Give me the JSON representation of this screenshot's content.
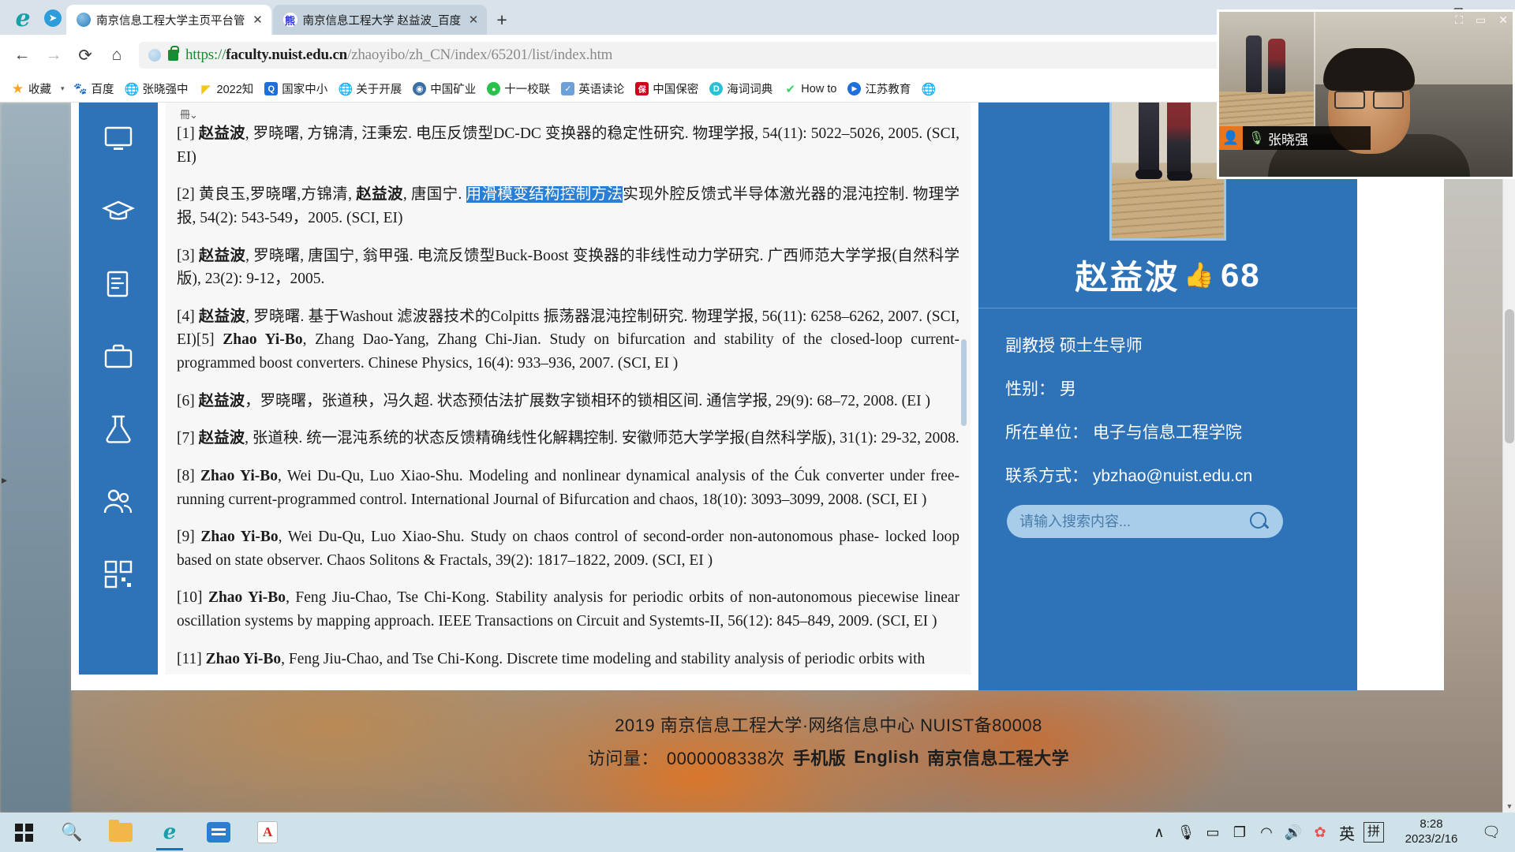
{
  "browser": {
    "tabs": [
      {
        "title": "南京信息工程大学主页平台管",
        "favicon": "globe-favicon",
        "active": true,
        "close_label": "✕"
      },
      {
        "title": "南京信息工程大学 赵益波_百度",
        "favicon": "baidu-favicon",
        "active": false,
        "close_label": "✕"
      }
    ],
    "new_tab_label": "+",
    "window_buttons": [
      "—",
      "❐",
      "✕"
    ],
    "nav": {
      "back": "←",
      "forward": "→",
      "reload": "⟳",
      "home": "⌂",
      "read_aloud": "⚡",
      "more": "⋯",
      "collections": "⌄"
    },
    "url": {
      "scheme": "https://",
      "host": "faculty.nuist.edu.cn",
      "path": "/zhaoyibo/zh_CN/index/65201/list/index.htm"
    },
    "bookmarks": [
      {
        "label": "收藏",
        "icon": "star-icon",
        "color": "#f5a623"
      },
      {
        "label": "百度",
        "icon": "baidu-icon",
        "color": "#2932e1"
      },
      {
        "label": "张晓强中",
        "icon": "globe-icon",
        "color": "#8d8d8d"
      },
      {
        "label": "2022知",
        "icon": "triangle-icon",
        "color": "#f5c518"
      },
      {
        "label": "国家中小",
        "icon": "app-icon",
        "color": "#1e6fd9"
      },
      {
        "label": "关于开展",
        "icon": "globe-icon",
        "color": "#8d8d8d"
      },
      {
        "label": "中国矿业",
        "icon": "seal-icon",
        "color": "#3b6ea5"
      },
      {
        "label": "十一校联",
        "icon": "wechat-icon",
        "color": "#27c24c"
      },
      {
        "label": "英语读论",
        "icon": "doc-icon",
        "color": "#6ca0d6"
      },
      {
        "label": "中国保密",
        "icon": "shield-icon",
        "color": "#d0021b"
      },
      {
        "label": "海词词典",
        "icon": "dict-icon",
        "color": "#29c1d6"
      },
      {
        "label": "How to",
        "icon": "leaf-icon",
        "color": "#3dd16a"
      },
      {
        "label": "江苏教育",
        "icon": "play-icon",
        "color": "#1e6fd9"
      },
      {
        "label": "",
        "icon": "globe-icon",
        "color": "#8d8d8d"
      }
    ],
    "bookmark_caret": "▾"
  },
  "page": {
    "rail_items": [
      {
        "name": "monitor-icon"
      },
      {
        "name": "graduation-cap-icon"
      },
      {
        "name": "document-pen-icon"
      },
      {
        "name": "briefcase-icon"
      },
      {
        "name": "flask-icon"
      },
      {
        "name": "people-icon"
      },
      {
        "name": "qrcode-icon"
      }
    ],
    "fragment_glyph": "冊⌄",
    "publications": [
      "[1] 赵益波, 罗晓曙, 方锦清, 汪秉宏. 电压反馈型DC-DC 变换器的稳定性研究. 物理学报, 54(11): 5022–5026, 2005. (SCI, EI)",
      "[2] 黄良玉,罗晓曙,方锦清, 赵益波, 唐国宁. 用滑模变结构控制方法实现外腔反馈式半导体激光器的混沌控制. 物理学报, 54(2): 543-549，2005. (SCI, EI)",
      "[3] 赵益波, 罗晓曙, 唐国宁, 翁甲强. 电流反馈型Buck-Boost 变换器的非线性动力学研究. 广西师范大学学报(自然科学版), 23(2): 9-12，2005.",
      "[4] 赵益波, 罗晓曙. 基于Washout 滤波器技术的Colpitts 振荡器混沌控制研究. 物理学报, 56(11): 6258–6262, 2007. (SCI, EI)[5] Zhao Yi-Bo, Zhang Dao-Yang, Zhang Chi-Jian. Study on bifurcation and stability of the closed-loop current-programmed boost converters. Chinese Physics, 16(4): 933–936, 2007. (SCI, EI )",
      "[6] 赵益波，罗晓曙，张道秧，冯久超. 状态预估法扩展数字锁相环的锁相区间. 通信学报, 29(9): 68–72, 2008. (EI )",
      "[7] 赵益波, 张道秧. 统一混沌系统的状态反馈精确线性化解耦控制. 安徽师范大学学报(自然科学版), 31(1): 29-32, 2008.",
      "[8] Zhao Yi-Bo, Wei Du-Qu, Luo Xiao-Shu. Modeling and nonlinear dynamical analysis of the Ćuk converter under free-running current-programmed control.  International Journal of Bifurcation and chaos, 18(10): 3093–3099, 2008. (SCI, EI )",
      "[9] Zhao Yi-Bo, Wei Du-Qu, Luo Xiao-Shu. Study on chaos control of second-order non-autonomous phase- locked loop based on state observer. Chaos Solitons & Fractals, 39(2): 1817–1822, 2009. (SCI, EI )",
      "[10] Zhao Yi-Bo, Feng Jiu-Chao, Tse Chi-Kong. Stability analysis for periodic orbits of non-autonomous piecewise linear oscillation systems by mapping approach. IEEE Transactions on Circuit and Systemts-II, 56(12): 845–849, 2009. (SCI, EI )",
      "[11] Zhao Yi-Bo, Feng Jiu-Chao, and Tse Chi-Kong. Discrete time modeling and stability analysis of periodic orbits with"
    ],
    "highlight_text": "用滑模变结构控制方法",
    "profile": {
      "name": "赵益波",
      "thumbs_icon": "thumbs-up-icon",
      "likes": "68",
      "title_line": "副教授 硕士生导师",
      "fields": [
        {
          "label": "性别：",
          "value": "男"
        },
        {
          "label": "所在单位：",
          "value": "电子与信息工程学院"
        },
        {
          "label": "联系方式：",
          "value": "ybzhao@nuist.edu.cn"
        }
      ],
      "search_placeholder": "请输入搜索内容...",
      "search_value": "",
      "search_icon": "search-icon"
    },
    "footer": {
      "line1": "2019 南京信息工程大学·网络信息中心 NUIST备80008",
      "visits_label": "访问量：",
      "visits_value": "0000008338次",
      "links": [
        "手机版",
        "English",
        "南京信息工程大学"
      ]
    }
  },
  "video_call": {
    "participant_name": "张晓强",
    "avatar_icon": "person-icon",
    "mic_icon": "microphone-icon",
    "top_buttons": [
      "⛶",
      "▭",
      "✕"
    ]
  },
  "taskbar": {
    "start_icon": "windows-logo",
    "search_icon": "search-icon",
    "apps": [
      {
        "name": "file-explorer-icon"
      },
      {
        "name": "edge-browser-icon",
        "active": true
      },
      {
        "name": "wps-office-icon"
      },
      {
        "name": "pdf-reader-icon"
      }
    ],
    "tray": [
      {
        "name": "show-hidden-icons",
        "glyph": "∧"
      },
      {
        "name": "microphone-icon",
        "glyph": "🎙"
      },
      {
        "name": "battery-icon",
        "glyph": "▭"
      },
      {
        "name": "display-settings-icon",
        "glyph": "❐"
      },
      {
        "name": "wifi-icon",
        "glyph": "◠"
      },
      {
        "name": "volume-icon",
        "glyph": "🔊"
      },
      {
        "name": "sogou-icon",
        "glyph": "✿"
      },
      {
        "name": "input-lang-icon",
        "glyph": "英"
      },
      {
        "name": "pinyin-mode-icon",
        "glyph": "拼"
      }
    ],
    "clock_time": "8:28",
    "clock_date": "2023/2/16",
    "notification_icon": "▭"
  },
  "colors": {
    "accent_blue": "#2e72b8",
    "highlight_blue": "#2a7fd4",
    "link_green": "#1a8b33",
    "taskbar_bg": "#cfe2ea"
  }
}
